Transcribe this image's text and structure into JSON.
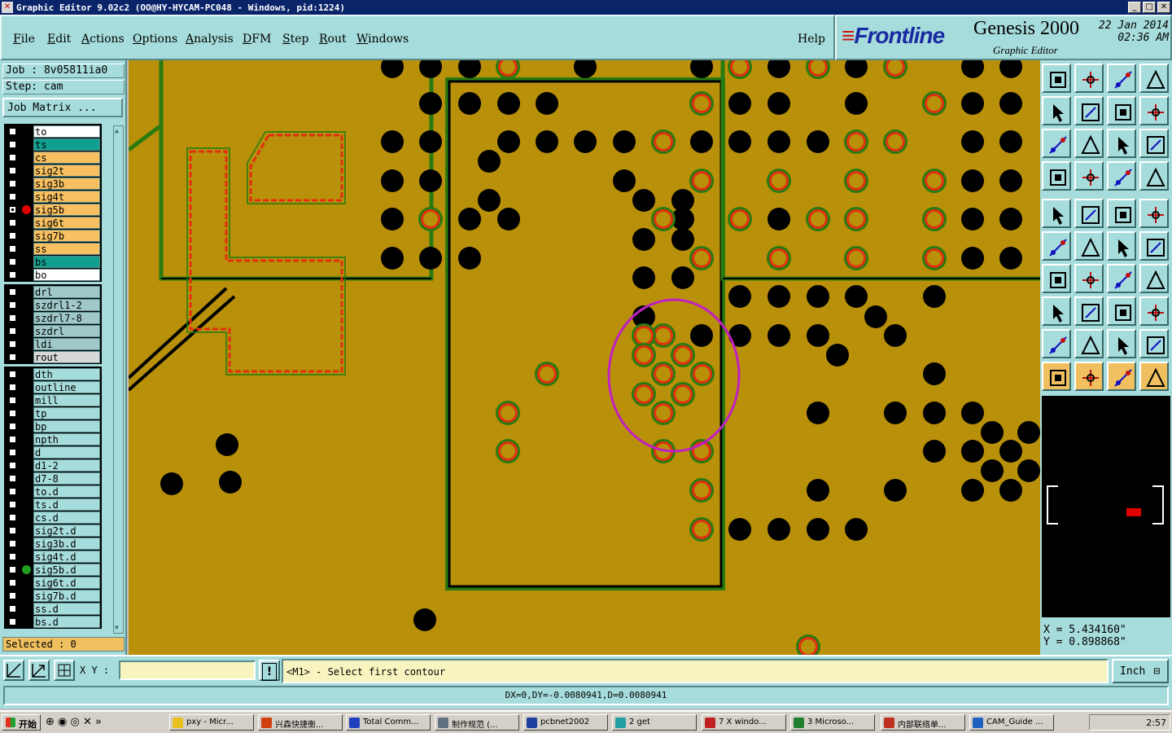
{
  "window": {
    "title": "Graphic Editor 9.02c2  (OO@HY-HYCAM-PC048 - Windows, pid:1224)"
  },
  "menu": [
    {
      "label": "File",
      "u": "F",
      "rest": "ile"
    },
    {
      "label": "Edit",
      "u": "E",
      "rest": "dit"
    },
    {
      "label": "Actions",
      "u": "A",
      "rest": "ctions"
    },
    {
      "label": "Options",
      "u": "O",
      "rest": "ptions"
    },
    {
      "label": "Analysis",
      "u": "A",
      "rest": "nalysis"
    },
    {
      "label": "DFM",
      "u": "D",
      "rest": "FM"
    },
    {
      "label": "Step",
      "u": "S",
      "rest": "tep"
    },
    {
      "label": "Rout",
      "u": "R",
      "rest": "out"
    },
    {
      "label": "Windows",
      "u": "W",
      "rest": "indows"
    }
  ],
  "help_label": "Help",
  "brand": {
    "logo": "Frontline",
    "product": "Genesis 2000",
    "subtitle": "Graphic Editor",
    "date": "22 Jan 2014",
    "time": "02:36 AM"
  },
  "job": {
    "job_label": "Job : 8v05811ia0",
    "step_label": "Step: cam",
    "matrix_button": "Job Matrix ..."
  },
  "layers": [
    {
      "name": "to",
      "color": "#ffffff",
      "checked": false
    },
    {
      "name": "ts",
      "color": "#10a090",
      "checked": false
    },
    {
      "name": "cs",
      "color": "#f8c060",
      "checked": false
    },
    {
      "name": "sig2t",
      "color": "#f8c060",
      "checked": false
    },
    {
      "name": "sig3b",
      "color": "#f8c060",
      "checked": false
    },
    {
      "name": "sig4t",
      "color": "#f8c060",
      "checked": false
    },
    {
      "name": "sig5b",
      "color": "#f8c060",
      "checked": true,
      "mark": "#e00000"
    },
    {
      "name": "sig6t",
      "color": "#f8c060",
      "checked": false
    },
    {
      "name": "sig7b",
      "color": "#f8c060",
      "checked": false
    },
    {
      "name": "ss",
      "color": "#f8c060",
      "checked": false
    },
    {
      "name": "bs",
      "color": "#10a090",
      "checked": false
    },
    {
      "name": "bo",
      "color": "#ffffff",
      "checked": false
    },
    {
      "name": "drl",
      "color": "#a0c8c8",
      "checked": false
    },
    {
      "name": "szdrl1-2",
      "color": "#a0c8c8",
      "checked": false
    },
    {
      "name": "szdrl7-8",
      "color": "#a0c8c8",
      "checked": false
    },
    {
      "name": "szdrl",
      "color": "#a0c8c8",
      "checked": false
    },
    {
      "name": "ldi",
      "color": "#a0c8c8",
      "checked": false
    },
    {
      "name": "rout",
      "color": "#d8d8d8",
      "checked": false
    },
    {
      "name": "dth",
      "color": "#a7dcdc",
      "checked": false
    },
    {
      "name": "outline",
      "color": "#a7dcdc",
      "checked": false
    },
    {
      "name": "mill",
      "color": "#a7dcdc",
      "checked": false
    },
    {
      "name": "tp",
      "color": "#a7dcdc",
      "checked": false
    },
    {
      "name": "bp",
      "color": "#a7dcdc",
      "checked": false
    },
    {
      "name": "npth",
      "color": "#a7dcdc",
      "checked": false
    },
    {
      "name": "d",
      "color": "#a7dcdc",
      "checked": false
    },
    {
      "name": "d1-2",
      "color": "#a7dcdc",
      "checked": false
    },
    {
      "name": "d7-8",
      "color": "#a7dcdc",
      "checked": false
    },
    {
      "name": "to.d",
      "color": "#a7dcdc",
      "checked": false
    },
    {
      "name": "ts.d",
      "color": "#a7dcdc",
      "checked": false
    },
    {
      "name": "cs.d",
      "color": "#a7dcdc",
      "checked": false
    },
    {
      "name": "sig2t.d",
      "color": "#a7dcdc",
      "checked": false
    },
    {
      "name": "sig3b.d",
      "color": "#a7dcdc",
      "checked": false
    },
    {
      "name": "sig4t.d",
      "color": "#a7dcdc",
      "checked": false
    },
    {
      "name": "sig5b.d",
      "color": "#a7dcdc",
      "checked": false,
      "mark": "#20a020"
    },
    {
      "name": "sig6t.d",
      "color": "#a7dcdc",
      "checked": false
    },
    {
      "name": "sig7b.d",
      "color": "#a7dcdc",
      "checked": false
    },
    {
      "name": "ss.d",
      "color": "#a7dcdc",
      "checked": false
    },
    {
      "name": "bs.d",
      "color": "#a7dcdc",
      "checked": false
    }
  ],
  "selected_label": "Selected : 0",
  "command": {
    "xy_label": "X Y :",
    "xy_value": "",
    "prompt": "<M1> - Select first contour",
    "unit": "Inch"
  },
  "coords": {
    "x": "X  =  5.434160\"",
    "y": "Y  =  0.898868\""
  },
  "status": "DX=0,DY=-0.0080941,D=0.0080941",
  "taskbar": {
    "start": "开始",
    "items": [
      "pxy - Micr...",
      "兴森快捷衡...",
      "Total Comm...",
      "制作规范 (...",
      "pcbnet2002",
      "2 get",
      "7 X windo...",
      "3 Microso...",
      "内部联络单...",
      "CAM_Guide ..."
    ],
    "clock": "2:57"
  },
  "colors": {
    "board": "#b8900a",
    "pad_black": "#000000",
    "pad_ring": "#e03010",
    "trace_green": "#2a7a10",
    "highlight": "#c020c0"
  }
}
